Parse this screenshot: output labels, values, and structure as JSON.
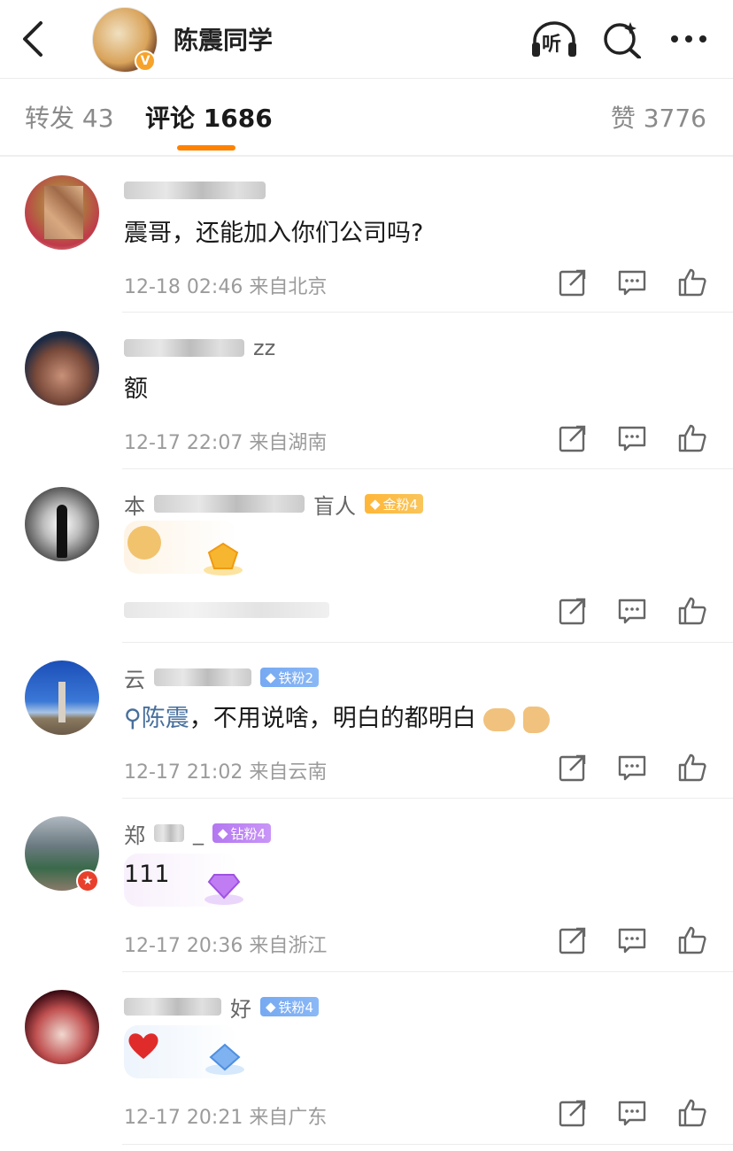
{
  "header": {
    "title": "陈震同学",
    "verified_badge": "V",
    "listen_label": "听"
  },
  "tabs": {
    "repost": "转发 43",
    "comment": "评论 1686",
    "like": "赞 3776"
  },
  "comments": [
    {
      "name_suffix": "",
      "text": "震哥，还能加入你们公司吗?",
      "meta": "12-18 02:46 来自北京",
      "fan_badge": ""
    },
    {
      "name_suffix": "zz",
      "text": "额",
      "meta": "12-17 22:07 来自湖南",
      "fan_badge": ""
    },
    {
      "name_prefix": "本",
      "name_suffix": "盲人",
      "text": "",
      "meta": "",
      "fan_badge": "金粉4"
    },
    {
      "name_prefix": "云",
      "name_suffix": "",
      "text_link": "陈震",
      "text": "，不用说啥，明白的都明白",
      "meta": "12-17 21:02 来自云南",
      "fan_badge": "铁粉2"
    },
    {
      "name_prefix": "郑",
      "name_suffix": "_",
      "text": "111",
      "meta": "12-17 20:36 来自浙江",
      "fan_badge": "钻粉4"
    },
    {
      "name_prefix": "",
      "name_suffix": "好",
      "text": "",
      "meta": "12-17 20:21 来自广东",
      "fan_badge": "铁粉4"
    }
  ],
  "colors": {
    "accent": "#ff8200",
    "link": "#476f9c",
    "gold_badge": "#ffb638",
    "iron_badge": "#76a9f2",
    "diamond_badge": "#b378f0"
  },
  "icons": [
    "back-icon",
    "headphones-icon",
    "search-sparkle-icon",
    "more-icon",
    "share-icon",
    "comment-icon",
    "like-icon"
  ]
}
